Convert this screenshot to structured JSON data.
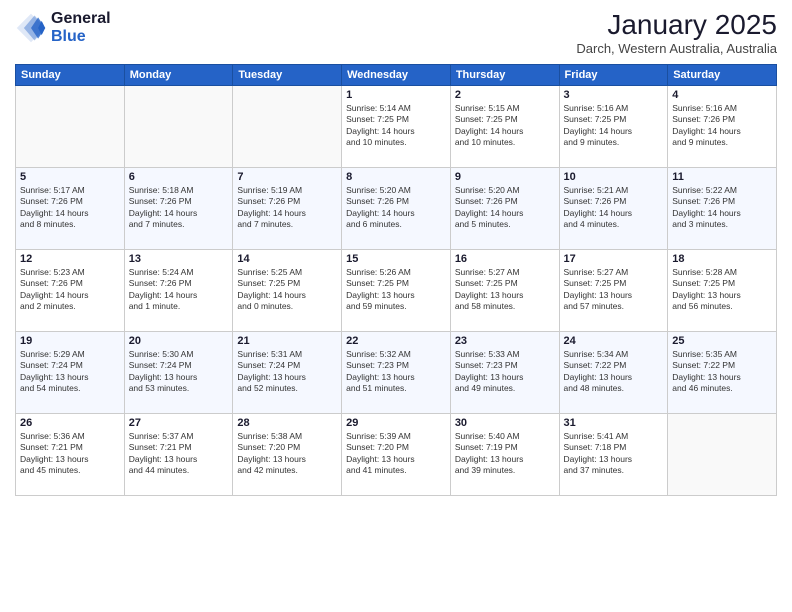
{
  "header": {
    "logo_line1": "General",
    "logo_line2": "Blue",
    "month_title": "January 2025",
    "subtitle": "Darch, Western Australia, Australia"
  },
  "weekdays": [
    "Sunday",
    "Monday",
    "Tuesday",
    "Wednesday",
    "Thursday",
    "Friday",
    "Saturday"
  ],
  "weeks": [
    [
      {
        "day": "",
        "detail": ""
      },
      {
        "day": "",
        "detail": ""
      },
      {
        "day": "",
        "detail": ""
      },
      {
        "day": "1",
        "detail": "Sunrise: 5:14 AM\nSunset: 7:25 PM\nDaylight: 14 hours\nand 10 minutes."
      },
      {
        "day": "2",
        "detail": "Sunrise: 5:15 AM\nSunset: 7:25 PM\nDaylight: 14 hours\nand 10 minutes."
      },
      {
        "day": "3",
        "detail": "Sunrise: 5:16 AM\nSunset: 7:25 PM\nDaylight: 14 hours\nand 9 minutes."
      },
      {
        "day": "4",
        "detail": "Sunrise: 5:16 AM\nSunset: 7:26 PM\nDaylight: 14 hours\nand 9 minutes."
      }
    ],
    [
      {
        "day": "5",
        "detail": "Sunrise: 5:17 AM\nSunset: 7:26 PM\nDaylight: 14 hours\nand 8 minutes."
      },
      {
        "day": "6",
        "detail": "Sunrise: 5:18 AM\nSunset: 7:26 PM\nDaylight: 14 hours\nand 7 minutes."
      },
      {
        "day": "7",
        "detail": "Sunrise: 5:19 AM\nSunset: 7:26 PM\nDaylight: 14 hours\nand 7 minutes."
      },
      {
        "day": "8",
        "detail": "Sunrise: 5:20 AM\nSunset: 7:26 PM\nDaylight: 14 hours\nand 6 minutes."
      },
      {
        "day": "9",
        "detail": "Sunrise: 5:20 AM\nSunset: 7:26 PM\nDaylight: 14 hours\nand 5 minutes."
      },
      {
        "day": "10",
        "detail": "Sunrise: 5:21 AM\nSunset: 7:26 PM\nDaylight: 14 hours\nand 4 minutes."
      },
      {
        "day": "11",
        "detail": "Sunrise: 5:22 AM\nSunset: 7:26 PM\nDaylight: 14 hours\nand 3 minutes."
      }
    ],
    [
      {
        "day": "12",
        "detail": "Sunrise: 5:23 AM\nSunset: 7:26 PM\nDaylight: 14 hours\nand 2 minutes."
      },
      {
        "day": "13",
        "detail": "Sunrise: 5:24 AM\nSunset: 7:26 PM\nDaylight: 14 hours\nand 1 minute."
      },
      {
        "day": "14",
        "detail": "Sunrise: 5:25 AM\nSunset: 7:25 PM\nDaylight: 14 hours\nand 0 minutes."
      },
      {
        "day": "15",
        "detail": "Sunrise: 5:26 AM\nSunset: 7:25 PM\nDaylight: 13 hours\nand 59 minutes."
      },
      {
        "day": "16",
        "detail": "Sunrise: 5:27 AM\nSunset: 7:25 PM\nDaylight: 13 hours\nand 58 minutes."
      },
      {
        "day": "17",
        "detail": "Sunrise: 5:27 AM\nSunset: 7:25 PM\nDaylight: 13 hours\nand 57 minutes."
      },
      {
        "day": "18",
        "detail": "Sunrise: 5:28 AM\nSunset: 7:25 PM\nDaylight: 13 hours\nand 56 minutes."
      }
    ],
    [
      {
        "day": "19",
        "detail": "Sunrise: 5:29 AM\nSunset: 7:24 PM\nDaylight: 13 hours\nand 54 minutes."
      },
      {
        "day": "20",
        "detail": "Sunrise: 5:30 AM\nSunset: 7:24 PM\nDaylight: 13 hours\nand 53 minutes."
      },
      {
        "day": "21",
        "detail": "Sunrise: 5:31 AM\nSunset: 7:24 PM\nDaylight: 13 hours\nand 52 minutes."
      },
      {
        "day": "22",
        "detail": "Sunrise: 5:32 AM\nSunset: 7:23 PM\nDaylight: 13 hours\nand 51 minutes."
      },
      {
        "day": "23",
        "detail": "Sunrise: 5:33 AM\nSunset: 7:23 PM\nDaylight: 13 hours\nand 49 minutes."
      },
      {
        "day": "24",
        "detail": "Sunrise: 5:34 AM\nSunset: 7:22 PM\nDaylight: 13 hours\nand 48 minutes."
      },
      {
        "day": "25",
        "detail": "Sunrise: 5:35 AM\nSunset: 7:22 PM\nDaylight: 13 hours\nand 46 minutes."
      }
    ],
    [
      {
        "day": "26",
        "detail": "Sunrise: 5:36 AM\nSunset: 7:21 PM\nDaylight: 13 hours\nand 45 minutes."
      },
      {
        "day": "27",
        "detail": "Sunrise: 5:37 AM\nSunset: 7:21 PM\nDaylight: 13 hours\nand 44 minutes."
      },
      {
        "day": "28",
        "detail": "Sunrise: 5:38 AM\nSunset: 7:20 PM\nDaylight: 13 hours\nand 42 minutes."
      },
      {
        "day": "29",
        "detail": "Sunrise: 5:39 AM\nSunset: 7:20 PM\nDaylight: 13 hours\nand 41 minutes."
      },
      {
        "day": "30",
        "detail": "Sunrise: 5:40 AM\nSunset: 7:19 PM\nDaylight: 13 hours\nand 39 minutes."
      },
      {
        "day": "31",
        "detail": "Sunrise: 5:41 AM\nSunset: 7:18 PM\nDaylight: 13 hours\nand 37 minutes."
      },
      {
        "day": "",
        "detail": ""
      }
    ]
  ]
}
